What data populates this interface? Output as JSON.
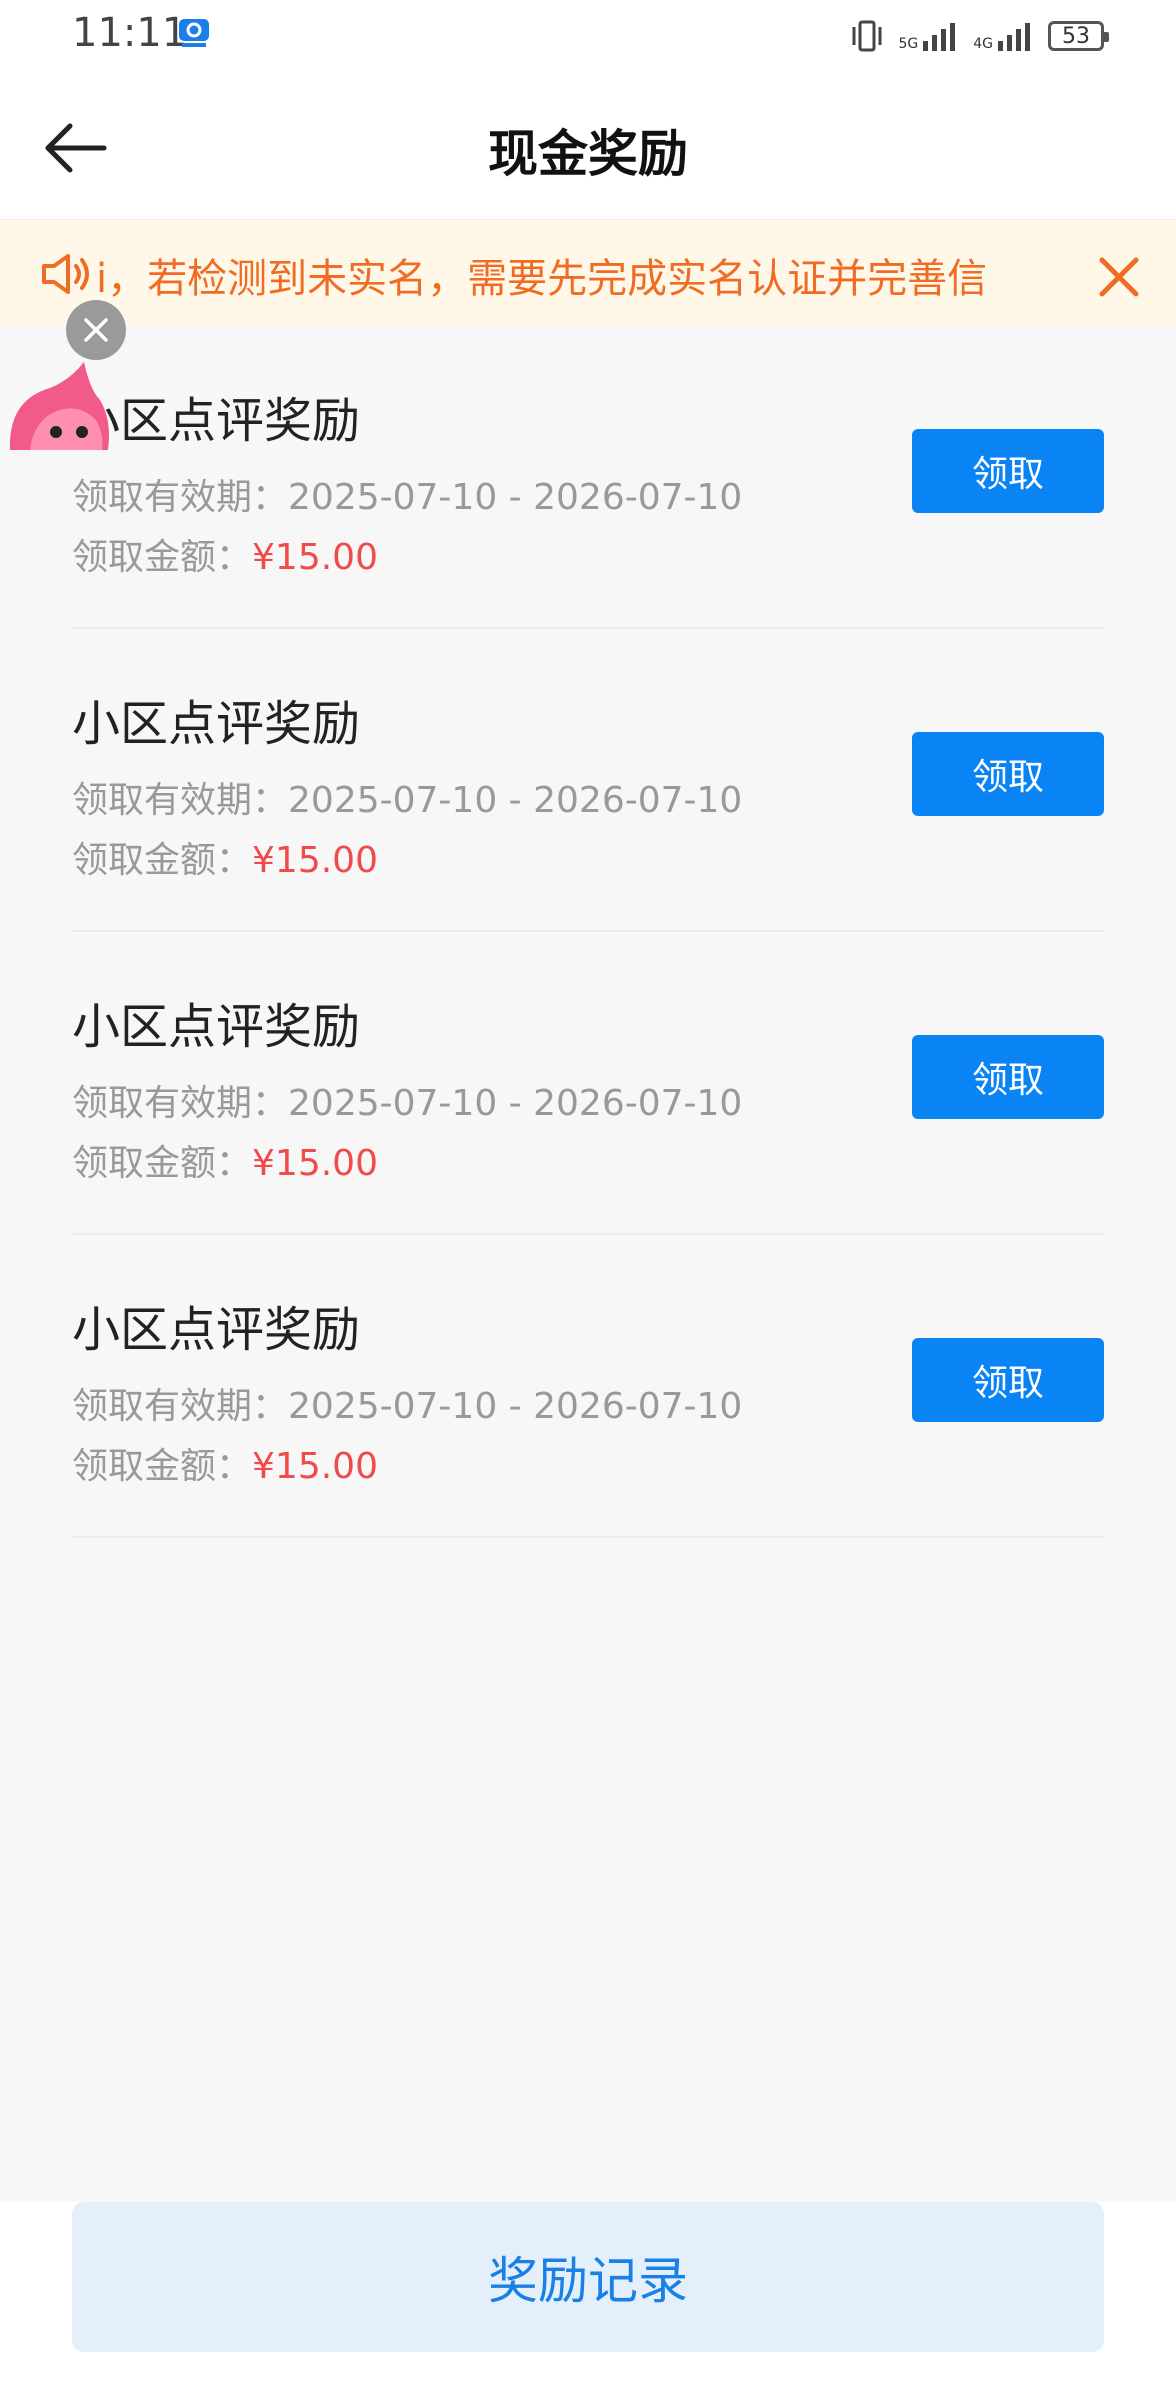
{
  "status_bar": {
    "time": "11:11",
    "network_1": "5G",
    "network_2": "4G",
    "battery": "53"
  },
  "header": {
    "title": "现金奖励",
    "back_icon": "arrow-left-icon"
  },
  "notice": {
    "text": "i，若检测到未实名，需要先完成实名认证并完善信",
    "speaker_icon": "speaker-icon",
    "close_icon": "close-icon",
    "color": "#f06c24",
    "background": "#fff8e8"
  },
  "rewards": [
    {
      "title": "小区点评奖励",
      "period_label": "领取有效期：",
      "period": "2025-07-10 - 2026-07-10",
      "amount_label": "领取金额：",
      "amount": "¥15.00",
      "button": "领取"
    },
    {
      "title": "小区点评奖励",
      "period_label": "领取有效期：",
      "period": "2025-07-10 - 2026-07-10",
      "amount_label": "领取金额：",
      "amount": "¥15.00",
      "button": "领取"
    },
    {
      "title": "小区点评奖励",
      "period_label": "领取有效期：",
      "period": "2025-07-10 - 2026-07-10",
      "amount_label": "领取金额：",
      "amount": "¥15.00",
      "button": "领取"
    },
    {
      "title": "小区点评奖励",
      "period_label": "领取有效期：",
      "period": "2025-07-10 - 2026-07-10",
      "amount_label": "领取金额：",
      "amount": "¥15.00",
      "button": "领取"
    }
  ],
  "bottom": {
    "records_button": "奖励记录"
  },
  "colors": {
    "primary": "#0a84f5",
    "amount": "#ef4b4b"
  }
}
